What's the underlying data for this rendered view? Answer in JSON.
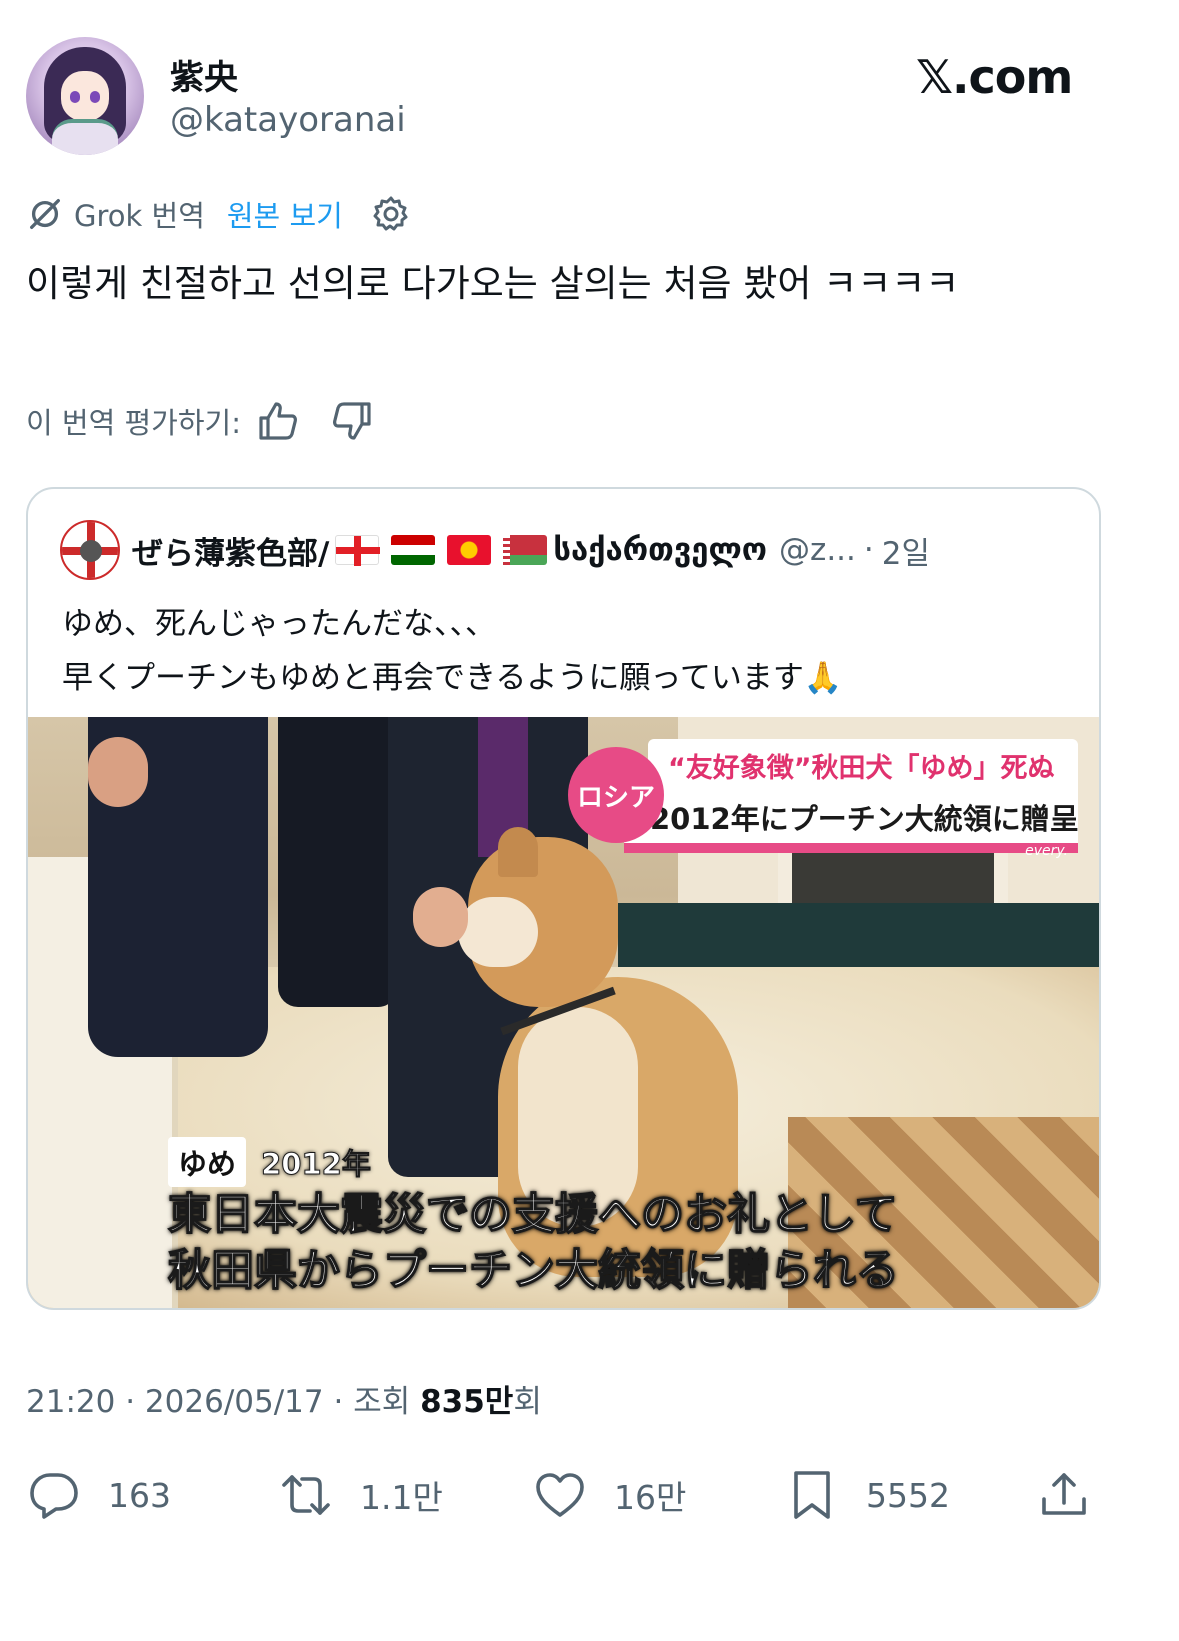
{
  "author": {
    "display_name": "紫央",
    "handle": "@katayoranai"
  },
  "brand": {
    "logo_text": "𝕏.com"
  },
  "translation": {
    "provider_label": "Grok 번역",
    "view_original": "원본 보기",
    "icons": [
      "grok-icon",
      "gear-icon"
    ]
  },
  "tweet": {
    "text": "이렇게 친절하고 선의로 다가오는 살의는 처음 봤어 ㅋㅋㅋㅋ"
  },
  "rating": {
    "label": "이 번역 평가하기:",
    "icons": [
      "thumbs-up-icon",
      "thumbs-down-icon"
    ]
  },
  "quote": {
    "name": "ぜら薄紫色部/",
    "script_name": "საქართველო",
    "handle": "@z...",
    "separator": "·",
    "time": "2일",
    "flags": [
      "georgia-flag",
      "tajikistan-flag",
      "kyrgyzstan-flag",
      "belarus-flag"
    ],
    "text_line1": "ゆめ、死んじゃったんだな、、、",
    "text_line2": "早くプーチンもゆめと再会できるように願っています🙏",
    "media": {
      "banner_tag": "ロシア",
      "banner_line1": "“友好象徴”秋田犬「ゆめ」死ぬ",
      "banner_line2": "2012年にプーチン大統領に贈呈",
      "banner_brand": "every.",
      "caption_tag": "ゆめ",
      "caption_year": "2012年",
      "caption_line1": "東日本大震災での支援へのお礼として",
      "caption_line2": "秋田県からプーチン大統領に贈られる",
      "accent_color": "#e74b86"
    }
  },
  "meta": {
    "time": "21:20",
    "dot1": "·",
    "date": "2026/05/17",
    "dot2": "·",
    "views_label": "조회",
    "views_count": "835만",
    "views_suffix": "회"
  },
  "actions": {
    "replies": "163",
    "reposts": "1.1만",
    "likes": "16만",
    "bookmarks": "5552",
    "icons": [
      "reply-icon",
      "repost-icon",
      "like-icon",
      "bookmark-icon",
      "share-icon"
    ]
  },
  "colors": {
    "text": "#0f1419",
    "secondary": "#536471",
    "link": "#1d9bf0",
    "border": "#cfd9de"
  }
}
